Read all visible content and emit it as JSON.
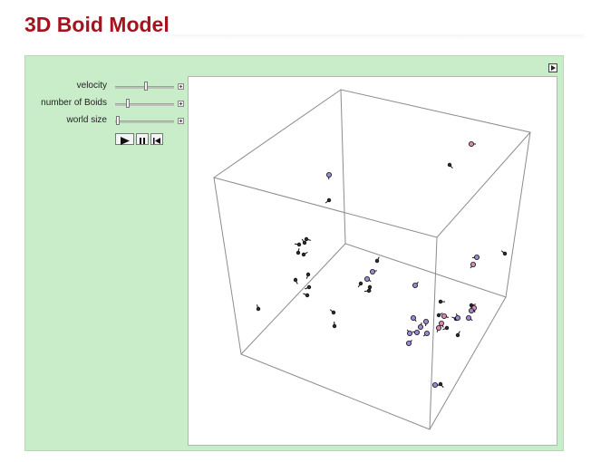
{
  "page": {
    "title": "3D Boid Model"
  },
  "controls": {
    "sliders": [
      {
        "label": "velocity",
        "value_fraction": 0.5
      },
      {
        "label": "number of Boids",
        "value_fraction": 0.18
      },
      {
        "label": "world size",
        "value_fraction": 0.0
      }
    ],
    "playback": {
      "play": "play-icon",
      "pause": "pause-icon",
      "reset": "step-back-icon"
    }
  },
  "colors": {
    "title": "#a6131f",
    "panel_background": "#c9ecc9",
    "boid_fill": "#9f86d6",
    "boid_fill_alt": "#d98ab8",
    "boid_fill_dark": "#2b2b3c"
  }
}
